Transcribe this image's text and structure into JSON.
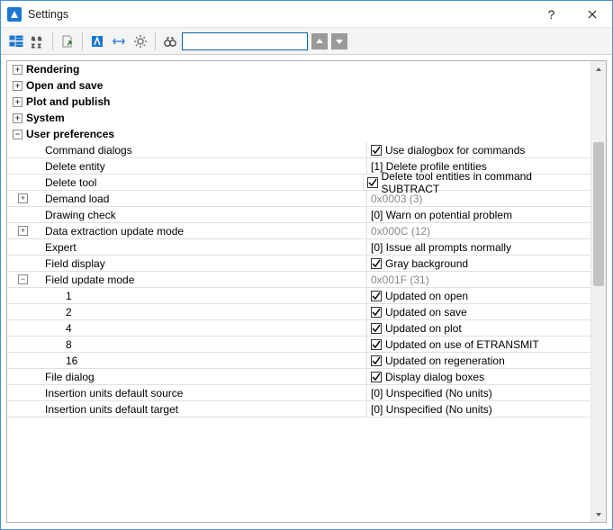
{
  "window": {
    "title": "Settings",
    "help": "?",
    "close": "×"
  },
  "toolbar": {
    "search_value": ""
  },
  "categories": {
    "rendering": {
      "label": "Rendering",
      "expanded": false
    },
    "open_save": {
      "label": "Open and save",
      "expanded": false
    },
    "plot_pub": {
      "label": "Plot and publish",
      "expanded": false
    },
    "system": {
      "label": "System",
      "expanded": false
    },
    "user_prefs": {
      "label": "User preferences",
      "expanded": true
    }
  },
  "prefs": {
    "command_dialogs": {
      "label": "Command dialogs",
      "type": "check",
      "checked": true,
      "text": "Use dialogbox for commands"
    },
    "delete_entity": {
      "label": "Delete entity",
      "type": "enum",
      "text": "[1] Delete profile entities"
    },
    "delete_tool": {
      "label": "Delete tool",
      "type": "check",
      "checked": true,
      "text": "Delete tool entities in command SUBTRACT"
    },
    "demand_load": {
      "label": "Demand load",
      "type": "flags",
      "summary": "0x0003 (3)",
      "expanded": false
    },
    "drawing_check": {
      "label": "Drawing check",
      "type": "enum",
      "text": "[0] Warn on potential problem"
    },
    "data_extract": {
      "label": "Data extraction update mode",
      "type": "flags",
      "summary": "0x000C (12)",
      "expanded": false
    },
    "expert": {
      "label": "Expert",
      "type": "enum",
      "text": "[0] Issue all prompts normally"
    },
    "field_display": {
      "label": "Field display",
      "type": "check",
      "checked": true,
      "text": "Gray background"
    },
    "field_update": {
      "label": "Field update mode",
      "type": "flags",
      "summary": "0x001F (31)",
      "expanded": true,
      "bits": [
        {
          "bit": "1",
          "checked": true,
          "text": "Updated on open"
        },
        {
          "bit": "2",
          "checked": true,
          "text": "Updated on save"
        },
        {
          "bit": "4",
          "checked": true,
          "text": "Updated on plot"
        },
        {
          "bit": "8",
          "checked": true,
          "text": "Updated on use of ETRANSMIT"
        },
        {
          "bit": "16",
          "checked": true,
          "text": "Updated on regeneration"
        }
      ]
    },
    "file_dialog": {
      "label": "File dialog",
      "type": "check",
      "checked": true,
      "text": "Display dialog boxes"
    },
    "ins_units_src": {
      "label": "Insertion units default source",
      "type": "enum",
      "text": "[0] Unspecified (No units)"
    },
    "ins_units_tgt": {
      "label": "Insertion units default target",
      "type": "enum",
      "text": "[0] Unspecified (No units)"
    }
  }
}
